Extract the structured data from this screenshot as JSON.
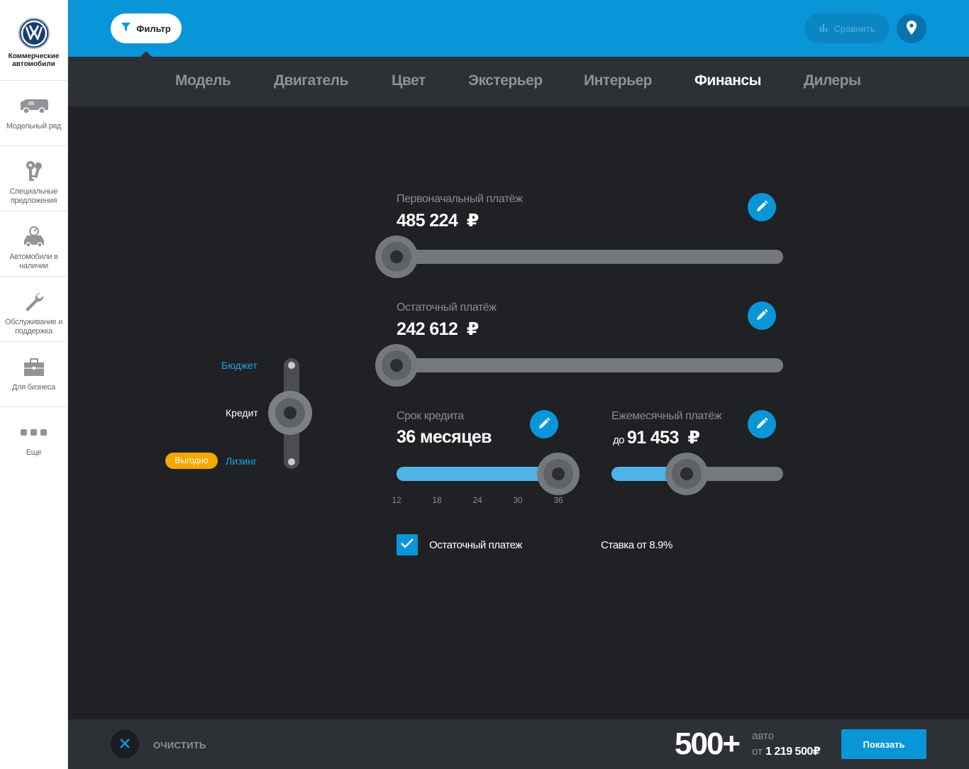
{
  "brand": {
    "name": "Коммерческие автомобили",
    "logo_text": "VW"
  },
  "sidebar": {
    "items": [
      {
        "label": "Модельный ряд",
        "icon": "van-icon"
      },
      {
        "label": "Специальные предложения",
        "icon": "keys-icon"
      },
      {
        "label": "Автомобили в наличии",
        "icon": "car-stock-icon"
      },
      {
        "label": "Обслуживание и поддержка",
        "icon": "wrench-icon"
      },
      {
        "label": "Для бизнеса",
        "icon": "briefcase-icon"
      },
      {
        "label": "Еще",
        "icon": "more-dots-icon"
      }
    ]
  },
  "topbar": {
    "filter_label": "Фильтр",
    "compare_label": "Сравнить",
    "location_icon": "location-pin-icon"
  },
  "tabs": [
    {
      "label": "Модель",
      "active": false
    },
    {
      "label": "Двигатель",
      "active": false
    },
    {
      "label": "Цвет",
      "active": false
    },
    {
      "label": "Экстерьер",
      "active": false
    },
    {
      "label": "Интерьер",
      "active": false
    },
    {
      "label": "Финансы",
      "active": true
    },
    {
      "label": "Дилеры",
      "active": false
    }
  ],
  "mode_switch": {
    "options": [
      "Бюджет",
      "Кредит",
      "Лизинг"
    ],
    "selected": "Кредит",
    "badge": "Выгодно"
  },
  "finance": {
    "initial_payment": {
      "title": "Первоначальный платёж",
      "value": "485 224",
      "currency": "₽",
      "slider_fraction": 0.0
    },
    "residual_payment": {
      "title": "Остаточный платёж",
      "value": "242 612",
      "currency": "₽",
      "slider_fraction": 0.0
    },
    "term": {
      "title": "Срок кредита",
      "value": "36 месяцев",
      "slider_value": 36,
      "min": 12,
      "max": 36,
      "ticks": [
        "12",
        "18",
        "24",
        "30",
        "36"
      ]
    },
    "monthly": {
      "title": "Ежемесячный платёж",
      "prefix": "до",
      "value": "91 453",
      "currency": "₽",
      "slider_fraction": 0.44
    },
    "residual_checkbox": {
      "label": "Остаточный платеж",
      "checked": true
    },
    "rate": "Ставка от 8.9%"
  },
  "bottombar": {
    "clear_label": "ОЧИСТИТЬ",
    "count": "500+",
    "count_unit": "авто",
    "price_prefix": "от",
    "price": "1 219 500",
    "price_currency": "₽",
    "show_label": "Показать"
  },
  "colors": {
    "accent": "#0996d9",
    "accent_light": "#4eb3e6",
    "badge": "#f5a800",
    "background": "#1f2124",
    "panel": "#2d3035"
  }
}
